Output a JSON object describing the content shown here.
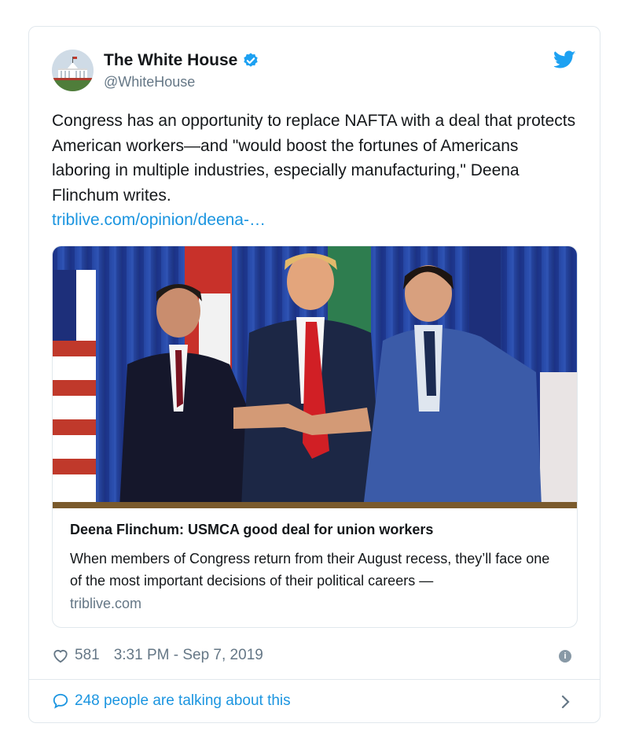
{
  "tweet": {
    "author_name": "The White House",
    "author_handle": "@WhiteHouse",
    "verified": true,
    "text": "Congress has an opportunity to replace NAFTA with a deal that protects American workers—and \"would boost the fortunes of Americans laboring in multiple industries, especially manufacturing,\" Deena Flinchum writes.",
    "link_text": "triblive.com/opinion/deena-…",
    "likes": "581",
    "timestamp": "3:31 PM - Sep 7, 2019",
    "conversation_text": "248 people are talking about this"
  },
  "link_card": {
    "title": "Deena Flinchum: USMCA good deal for union workers",
    "description": "When members of Congress return from their August recess, they’ll face one of the most important decisions of their political careers —",
    "domain": "triblive.com",
    "image_description_icon": "photo-three-leaders-handshake"
  },
  "icons": {
    "verified": "verified-badge-icon",
    "bird": "twitter-bird-icon",
    "heart": "heart-icon",
    "info": "info-icon",
    "bubble": "speech-bubble-icon",
    "chevron": "chevron-right-icon"
  },
  "colors": {
    "accent": "#1b95e0",
    "text": "#14171a",
    "secondary": "#657786",
    "border": "#e1e8ed"
  }
}
